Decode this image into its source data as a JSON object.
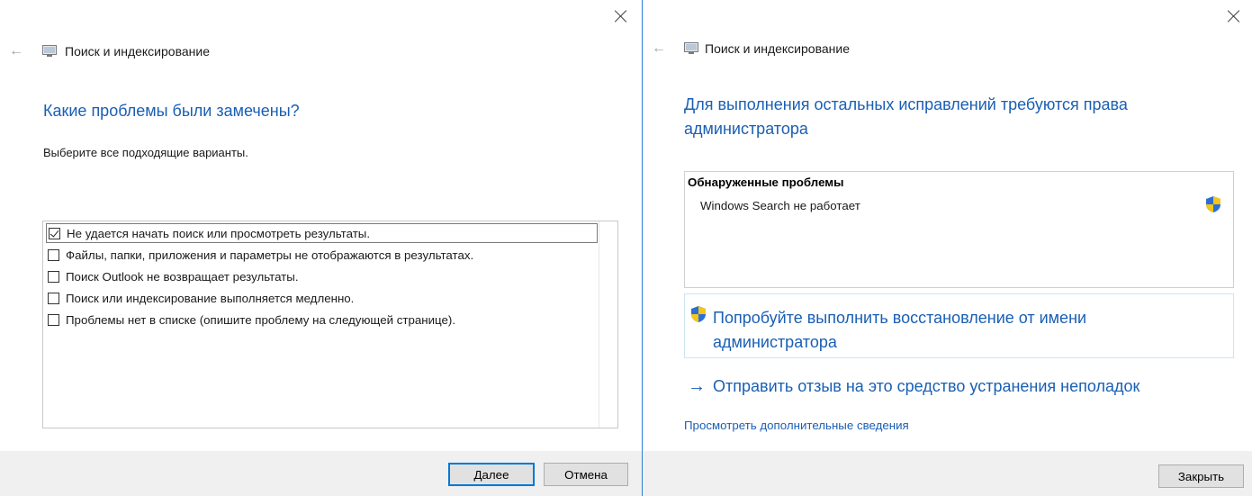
{
  "left_window": {
    "title": "Поиск и индексирование",
    "heading": "Какие проблемы были замечены?",
    "instruction": "Выберите все подходящие варианты.",
    "options": [
      {
        "label": "Не удается начать поиск или просмотреть результаты.",
        "checked": true
      },
      {
        "label": "Файлы, папки, приложения и параметры не отображаются в результатах.",
        "checked": false
      },
      {
        "label": "Поиск Outlook не возвращает результаты.",
        "checked": false
      },
      {
        "label": "Поиск или индексирование выполняется медленно.",
        "checked": false
      },
      {
        "label": "Проблемы нет в списке (опишите проблему на следующей странице).",
        "checked": false
      }
    ],
    "next_label": "Далее",
    "cancel_label": "Отмена"
  },
  "right_window": {
    "title": "Поиск и индексирование",
    "heading_line1": "Для выполнения остальных исправлений требуются права",
    "heading_line2": "администратора",
    "problems_title": "Обнаруженные проблемы",
    "problem": "Windows Search не работает",
    "admin_action": "Попробуйте выполнить восстановление от имени администратора",
    "feedback_link": "Отправить отзыв на это средство устранения неполадок",
    "details_link": "Просмотреть дополнительные сведения",
    "close_label": "Закрыть"
  },
  "icons": {
    "back": "back-arrow-icon",
    "close": "close-icon",
    "app": "troubleshooter-icon",
    "shield": "uac-shield-icon",
    "arrow": "arrow-right-icon"
  },
  "colors": {
    "accent": "#1a5fb4",
    "focus_border": "#0078d7",
    "footer_bg": "#f0f0f0"
  }
}
